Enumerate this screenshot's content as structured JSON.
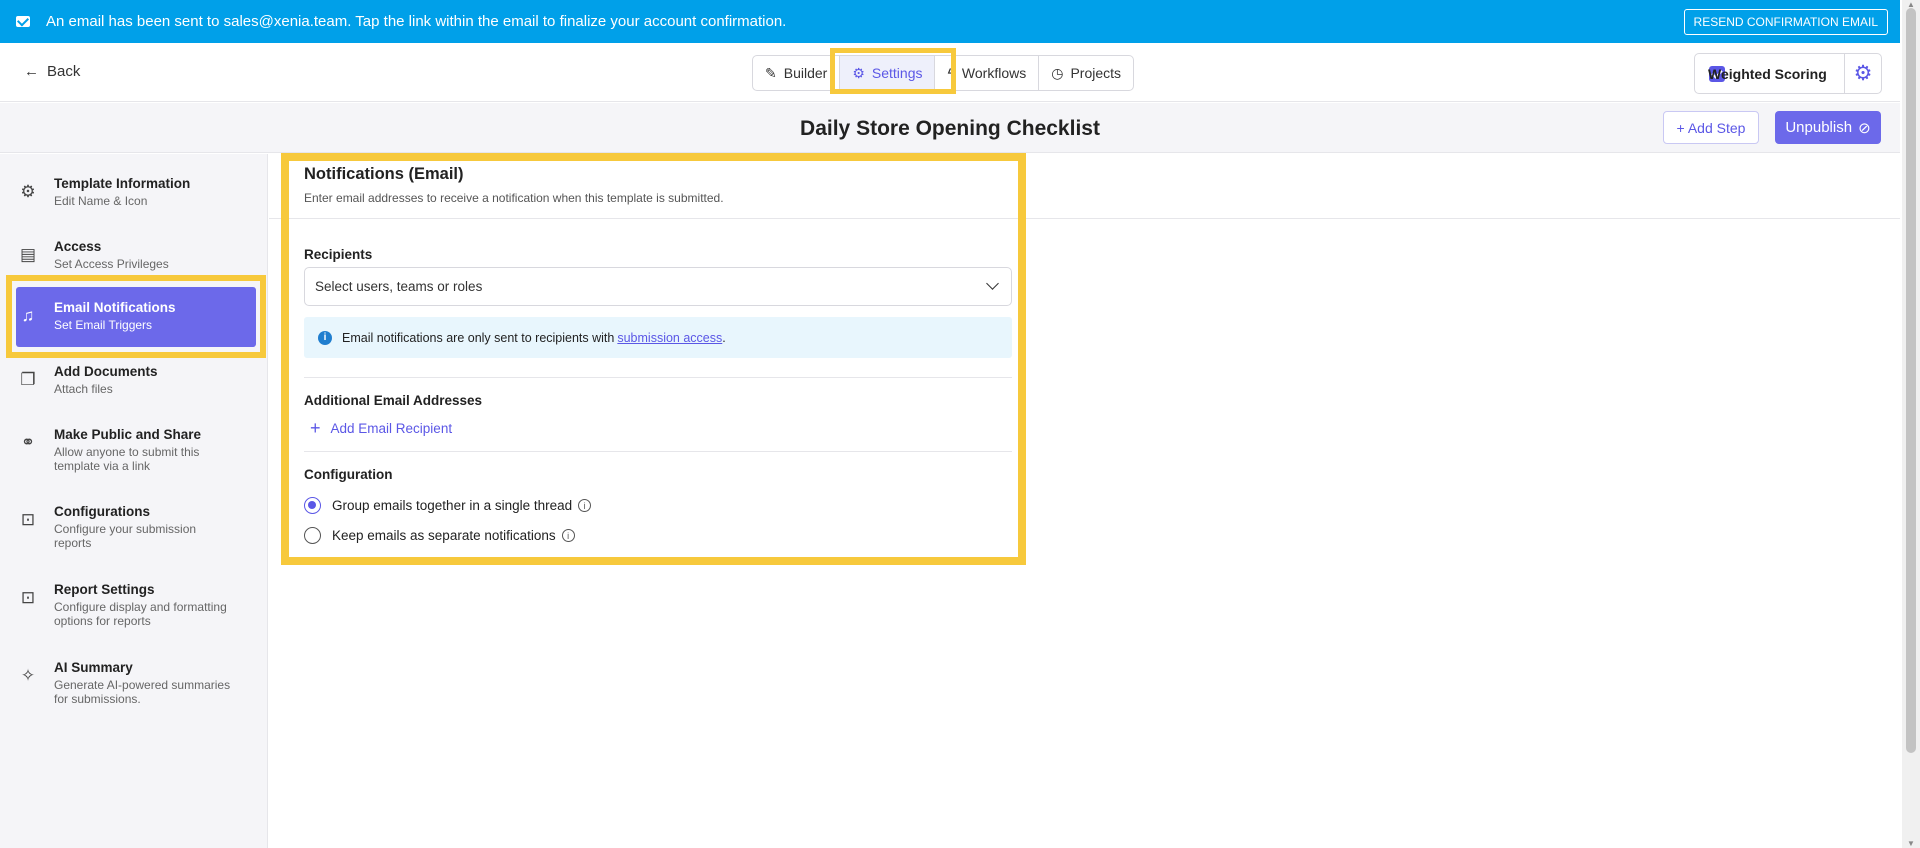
{
  "banner": {
    "message": "An email has been sent to sales@xenia.team. Tap the link within the email to finalize your account confirmation.",
    "resend_label": "RESEND CONFIRMATION EMAIL"
  },
  "nav": {
    "back_label": "Back",
    "tabs": [
      {
        "label": "Builder",
        "icon": "edit-icon"
      },
      {
        "label": "Settings",
        "icon": "gear-icon",
        "active": true
      },
      {
        "label": "Workflows",
        "icon": "lightning-icon"
      },
      {
        "label": "Projects",
        "icon": "clock-icon"
      }
    ],
    "weighted_scoring_label": "Weighted Scoring"
  },
  "title_bar": {
    "title": "Daily Store Opening Checklist",
    "add_step_label": "+ Add Step",
    "unpublish_label": "Unpublish"
  },
  "sidebar": {
    "items": [
      {
        "title": "Template Information",
        "desc": "Edit Name & Icon",
        "icon": "gear-icon"
      },
      {
        "title": "Access",
        "desc": "Set Access Privileges",
        "icon": "document-lock-icon"
      },
      {
        "title": "Email Notifications",
        "desc": "Set Email Triggers",
        "icon": "bell-icon",
        "active": true
      },
      {
        "title": "Add Documents",
        "desc": "Attach files",
        "icon": "documents-icon"
      },
      {
        "title": "Make Public and Share",
        "desc": "Allow anyone to submit this template via a link",
        "icon": "link-icon"
      },
      {
        "title": "Configurations",
        "desc": "Configure your submission reports",
        "icon": "presentation-icon"
      },
      {
        "title": "Report Settings",
        "desc": "Configure display and formatting options for reports",
        "icon": "presentation-icon"
      },
      {
        "title": "AI Summary",
        "desc": "Generate AI-powered summaries for submissions.",
        "icon": "sparkle-icon"
      }
    ]
  },
  "panel": {
    "title": "Notifications (Email)",
    "subtitle": "Enter email addresses to receive a notification when this template is submitted.",
    "recipients_label": "Recipients",
    "recipients_placeholder": "Select users, teams or roles",
    "info_text": "Email notifications are only sent to recipients with",
    "info_link": "submission access",
    "info_suffix": ".",
    "additional_label": "Additional Email Addresses",
    "add_recipient_label": "Add Email Recipient",
    "configuration_label": "Configuration",
    "options": [
      {
        "label": "Group emails together in a single thread",
        "selected": true
      },
      {
        "label": "Keep emails as separate notifications",
        "selected": false
      }
    ]
  },
  "colors": {
    "banner": "#00a0e9",
    "accent": "#6c69ea",
    "highlight": "#f7c93c"
  }
}
